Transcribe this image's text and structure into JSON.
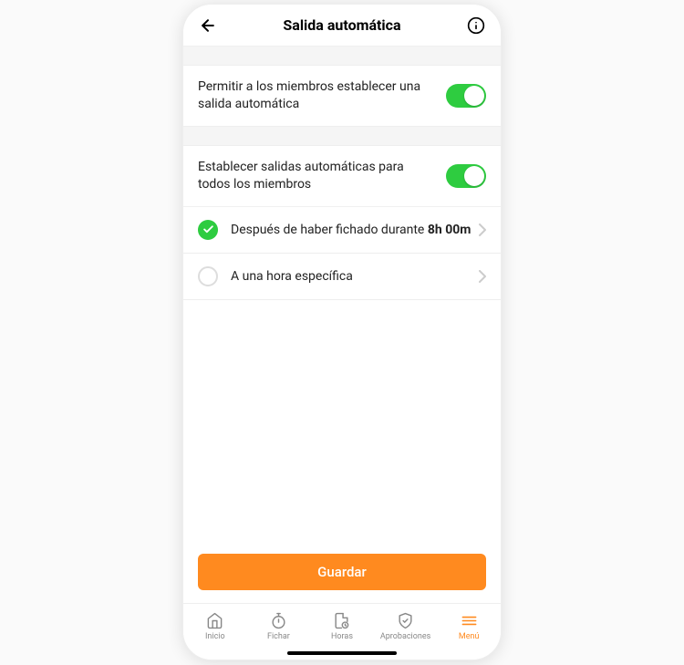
{
  "header": {
    "title": "Salida automática"
  },
  "settings": {
    "allow_members_label": "Permitir a los miembros establecer una salida automática",
    "set_all_label": "Establecer salidas automáticas para todos los miembros"
  },
  "options": {
    "after_clocked": {
      "label": "Después de haber fichado durante",
      "value": "8h 00m",
      "selected": true
    },
    "specific_time": {
      "label": "A una hora específica",
      "selected": false
    }
  },
  "actions": {
    "save_label": "Guardar"
  },
  "tabbar": {
    "home": "Inicio",
    "clock": "Fichar",
    "hours": "Horas",
    "approvals": "Aprobaciones",
    "menu": "Menú"
  }
}
